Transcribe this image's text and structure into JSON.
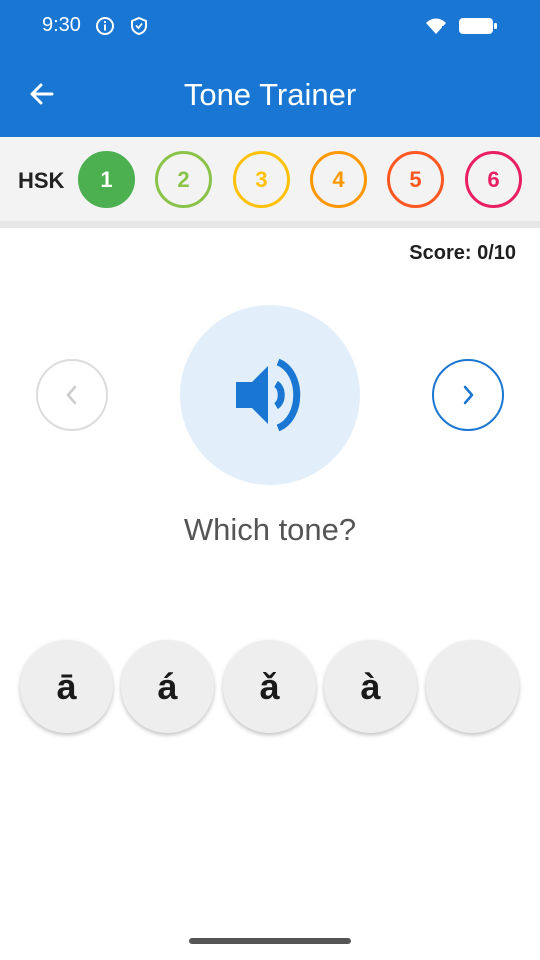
{
  "status_bar": {
    "time": "9:30",
    "icons": [
      "info-icon",
      "shield-icon",
      "wifi-icon",
      "battery-icon"
    ]
  },
  "app_bar": {
    "title": "Tone Trainer",
    "back_icon": "arrow-left-icon"
  },
  "hsk": {
    "label": "HSK",
    "selected": "1",
    "levels": [
      {
        "label": "1",
        "color": "#4caf50"
      },
      {
        "label": "2",
        "color": "#8bc34a"
      },
      {
        "label": "3",
        "color": "#ffc107"
      },
      {
        "label": "4",
        "color": "#ff9800"
      },
      {
        "label": "5",
        "color": "#ff5722"
      },
      {
        "label": "6",
        "color": "#e91e63"
      }
    ]
  },
  "score": {
    "text": "Score: 0/10"
  },
  "player": {
    "speaker_icon": "speaker-icon",
    "prev_icon": "chevron-left-icon",
    "next_icon": "chevron-right-icon"
  },
  "question": "Which tone?",
  "tones": [
    "ā",
    "á",
    "ǎ",
    "à",
    ""
  ],
  "colors": {
    "primary": "#1976d2",
    "speaker_bg": "#e3eefb"
  }
}
